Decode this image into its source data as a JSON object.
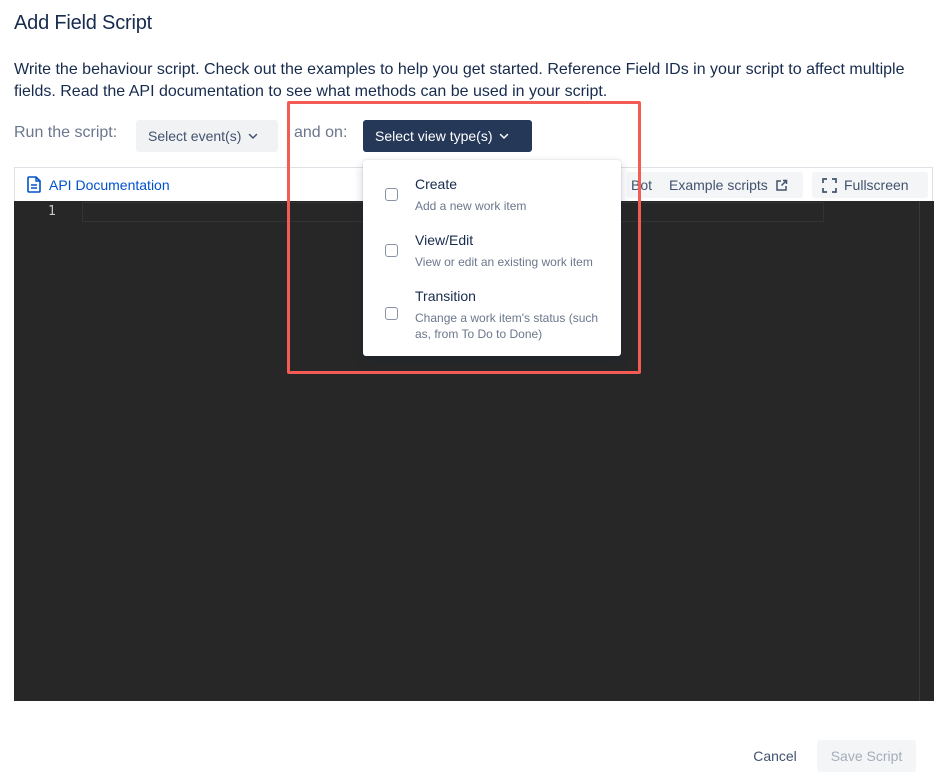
{
  "dialog": {
    "title": "Add Field Script",
    "description": "Write the behaviour script. Check out the examples to help you get started. Reference Field IDs in your script to affect multiple fields. Read the API documentation to see what methods can be used in your script."
  },
  "controls": {
    "run_label": "Run the script:",
    "events_button": "Select event(s)",
    "and_on_label": "and on:",
    "view_button": "Select view type(s)"
  },
  "toolbar": {
    "api_docs": "API Documentation",
    "bot_partial": "Bot",
    "example_scripts": "Example scripts",
    "fullscreen": "Fullscreen"
  },
  "editor": {
    "line_numbers": [
      "1"
    ]
  },
  "dropdown": {
    "options": [
      {
        "label": "Create",
        "description": "Add a new work item"
      },
      {
        "label": "View/Edit",
        "description": "View or edit an existing work item"
      },
      {
        "label": "Transition",
        "description": "Change a work item's status (such as, from To Do to Done)"
      }
    ]
  },
  "footer": {
    "cancel": "Cancel",
    "save": "Save Script"
  },
  "colors": {
    "highlight": "#f25c54",
    "primary_button": "#253858",
    "link": "#0052cc",
    "editor_bg": "#272727"
  }
}
